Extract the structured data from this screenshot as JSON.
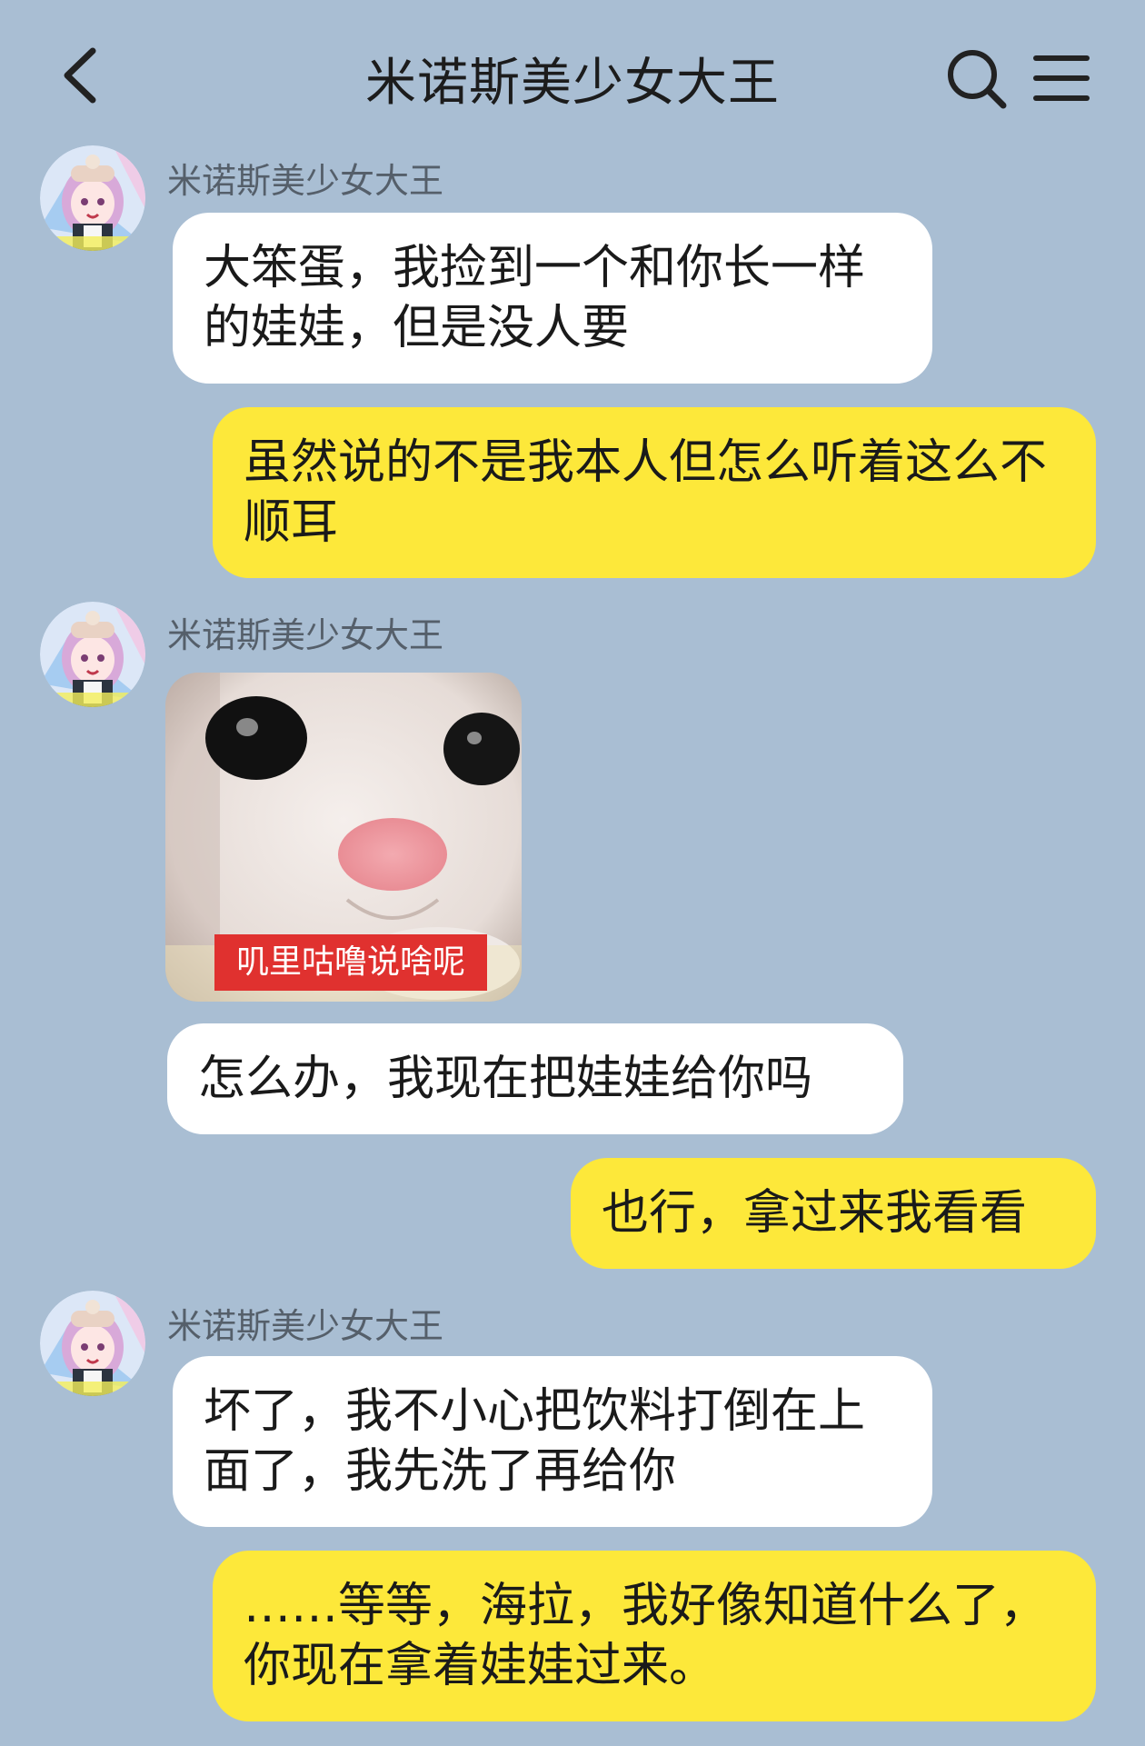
{
  "header": {
    "title": "米诺斯美少女大王",
    "back_icon": "chevron-left-icon",
    "search_icon": "search-icon",
    "menu_icon": "menu-icon"
  },
  "messages": [
    {
      "side": "left",
      "sender": "米诺斯美少女大王",
      "text": "大笨蛋，我捡到一个和你长一样的娃娃，但是没人要"
    },
    {
      "side": "right",
      "text": "虽然说的不是我本人但怎么听着这么不顺耳"
    },
    {
      "side": "left",
      "sender": "米诺斯美少女大王",
      "sticker_caption": "叽里咕噜说啥呢"
    },
    {
      "side": "left",
      "text": "怎么办，我现在把娃娃给你吗"
    },
    {
      "side": "right",
      "text": "也行，拿过来我看看"
    },
    {
      "side": "left",
      "sender": "米诺斯美少女大王",
      "text": "坏了，我不小心把饮料打倒在上面了，我先洗了再给你"
    },
    {
      "side": "right",
      "text": "……等等，海拉，我好像知道什么了，你现在拿着娃娃过来。"
    }
  ],
  "colors": {
    "background": "#a9bed3",
    "left_bubble": "#ffffff",
    "right_bubble": "#fde83a",
    "sticker_caption_bg": "#e0312f"
  }
}
